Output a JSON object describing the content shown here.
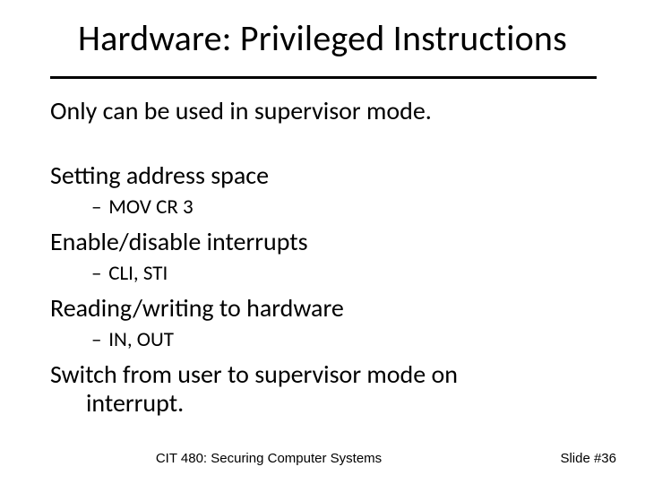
{
  "title": "Hardware: Privileged Instructions",
  "intro": "Only can be used in supervisor mode.",
  "items": [
    {
      "heading": "Setting address space",
      "sub": "MOV CR 3"
    },
    {
      "heading": "Enable/disable interrupts",
      "sub": "CLI, STI"
    },
    {
      "heading": "Reading/writing to hardware",
      "sub": "IN, OUT"
    }
  ],
  "closing_line1": "Switch from user to supervisor mode on",
  "closing_line2": "interrupt.",
  "footer_center": "CIT 480: Securing Computer Systems",
  "footer_right": "Slide #36"
}
